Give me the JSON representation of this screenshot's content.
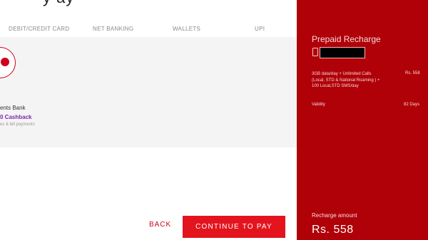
{
  "header": {
    "title_fragment": "y ay"
  },
  "tabs": [
    {
      "label": "DEBIT/CREDIT CARD"
    },
    {
      "label": "NET BANKING"
    },
    {
      "label": "WALLETS"
    },
    {
      "label": "UPI"
    }
  ],
  "payment_option": {
    "name": "ents Bank",
    "cashback": "0 Cashback",
    "subtext": "es & bill payments"
  },
  "actions": {
    "back_label": "BACK",
    "continue_label": "CONTINUE TO PAY"
  },
  "summary": {
    "title": "Prepaid Recharge",
    "plan_description": "3GB data/day + Unlimited Calls (Local, STD & National Roaming ) + 100 Local,STD SMS/day",
    "plan_price": "Rs. 558",
    "validity_label": "Validity",
    "validity_value": "82 Days",
    "amount_label": "Recharge amount",
    "amount_value": "Rs. 558"
  },
  "colors": {
    "accent_red": "#e3141e",
    "panel_red": "#b00008",
    "cashback_purple": "#7d2aa8"
  }
}
